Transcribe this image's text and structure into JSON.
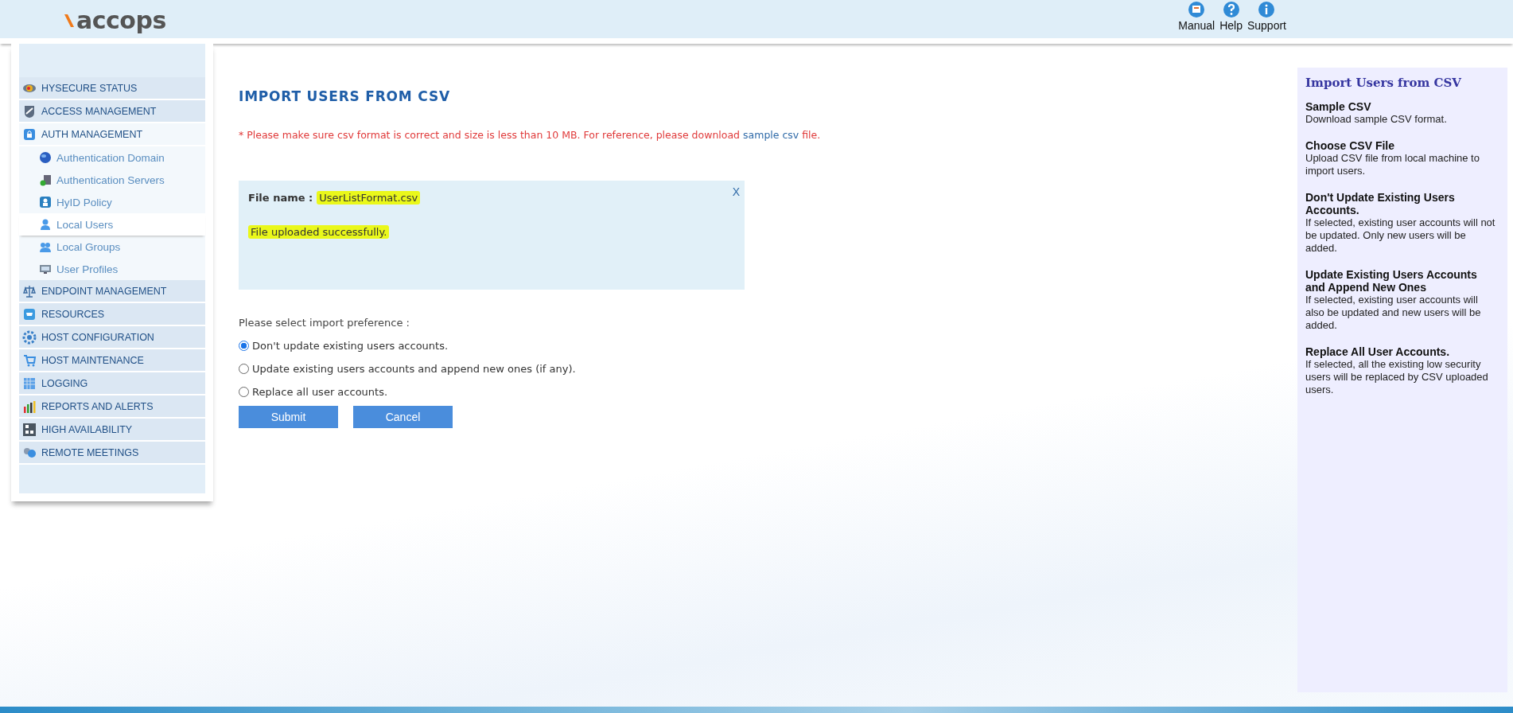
{
  "header": {
    "logo": "accops",
    "links": [
      {
        "label": "Manual"
      },
      {
        "label": "Help"
      },
      {
        "label": "Support"
      }
    ]
  },
  "sidebar": {
    "items": [
      {
        "label": "HYSECURE STATUS",
        "selected": false
      },
      {
        "label": "ACCESS MANAGEMENT",
        "selected": false
      },
      {
        "label": "AUTH MANAGEMENT",
        "selected": false,
        "expanded": true,
        "children": [
          {
            "label": "Authentication Domain",
            "selected": false
          },
          {
            "label": "Authentication Servers",
            "selected": false
          },
          {
            "label": "HyID Policy",
            "selected": false
          },
          {
            "label": "Local Users",
            "selected": true
          },
          {
            "label": "Local Groups",
            "selected": false
          },
          {
            "label": "User Profiles",
            "selected": false
          }
        ]
      },
      {
        "label": "ENDPOINT MANAGEMENT",
        "selected": false
      },
      {
        "label": "RESOURCES",
        "selected": false
      },
      {
        "label": "HOST CONFIGURATION",
        "selected": false
      },
      {
        "label": "HOST MAINTENANCE",
        "selected": false
      },
      {
        "label": "LOGGING",
        "selected": false
      },
      {
        "label": "REPORTS AND ALERTS",
        "selected": false
      },
      {
        "label": "HIGH AVAILABILITY",
        "selected": false
      },
      {
        "label": "REMOTE MEETINGS",
        "selected": false
      }
    ]
  },
  "main": {
    "title": "IMPORT USERS FROM CSV",
    "notice": {
      "text": "* Please make sure csv format is correct and size is less than 10 MB. For reference, please download",
      "link": "sample csv",
      "after": "file."
    },
    "upload": {
      "label": "File name :",
      "file_name": "UserListFormat.csv",
      "file_name_highlighted": true,
      "message": "File uploaded successfully.",
      "message_highlighted": true,
      "close": "X"
    },
    "preference_label": "Please select import preference :",
    "options": [
      {
        "label": "Don't update existing users accounts.",
        "selected": true
      },
      {
        "label": "Update existing users accounts and append new ones (if any).",
        "selected": false
      },
      {
        "label": "Replace all user accounts.",
        "selected": false
      }
    ],
    "buttons": [
      "Submit",
      "Cancel"
    ]
  },
  "help_panel": {
    "title": "Import Users from CSV",
    "sections": [
      {
        "heading": "Sample CSV",
        "text": "Download sample CSV format."
      },
      {
        "heading": "Choose CSV File",
        "text": "Upload CSV file from local machine to import users."
      },
      {
        "heading": "Don't Update Existing Users Accounts.",
        "text": "If selected, existing user accounts will not be updated. Only new users will be added."
      },
      {
        "heading": "Update Existing Users Accounts and Append New Ones",
        "text": "If selected, existing user accounts will also be updated and new users will be added."
      },
      {
        "heading": "Replace All User Accounts.",
        "text": "If selected, all the existing low security users will be replaced by CSV uploaded users."
      }
    ]
  }
}
